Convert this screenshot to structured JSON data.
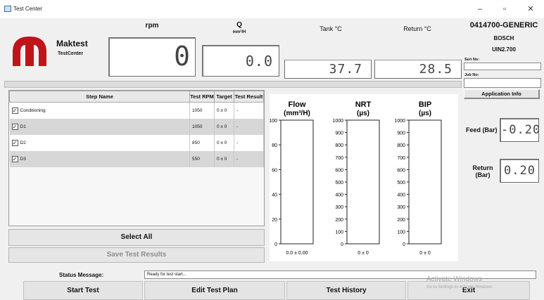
{
  "window": {
    "title": "Test Center",
    "minimize_glyph": "–",
    "maximize_glyph": "▫",
    "close_glyph": "✕"
  },
  "brand": {
    "name": "Maktest",
    "subtitle": "TestCenter",
    "logo_color": "#c0141b"
  },
  "readouts": {
    "rpm": {
      "label": "rpm",
      "value": "0"
    },
    "q": {
      "label": "Q",
      "unit": "mm³/H",
      "value": "0.0"
    },
    "tank": {
      "label": "Tank °C",
      "value": "37.7"
    },
    "return": {
      "label": "Return °C",
      "value": "28.5"
    }
  },
  "device": {
    "code": "0414700-GENERIC",
    "maker": "BOSCH",
    "uin": "UIN2.700",
    "serial_label": "Seri No:",
    "serial_value": "",
    "job_label": "Job No:",
    "job_value": "",
    "info_button": "Application Info"
  },
  "steps_table": {
    "headers": [
      "Step Name",
      "Test RPM",
      "Target",
      "Test Result"
    ],
    "rows": [
      {
        "checked": true,
        "name": "Conditioning",
        "rpm": "1050",
        "target": "0 ± 0",
        "result": "-"
      },
      {
        "checked": true,
        "name": "D1",
        "rpm": "1050",
        "target": "0 ± 0",
        "result": "-"
      },
      {
        "checked": true,
        "name": "D2",
        "rpm": "850",
        "target": "0 ± 0",
        "result": "-"
      },
      {
        "checked": true,
        "name": "D3",
        "rpm": "550",
        "target": "0 ± 0",
        "result": "-"
      }
    ],
    "check_glyph": "✓"
  },
  "buttons": {
    "select_all": "Select All",
    "save_results": "Save Test Results"
  },
  "chart_data": [
    {
      "type": "bar",
      "title": "Flow",
      "unit": "(mm³/H)",
      "ylim": [
        0,
        100
      ],
      "ticks": [
        "0",
        "20",
        "40",
        "60",
        "80",
        "100"
      ],
      "categories": [
        ""
      ],
      "values": [
        0
      ],
      "readout": "0.0 ± 0.00"
    },
    {
      "type": "bar",
      "title": "NRT",
      "unit": "(µs)",
      "ylim": [
        0,
        1000
      ],
      "ticks": [
        "0",
        "100",
        "200",
        "300",
        "400",
        "500",
        "600",
        "700",
        "800",
        "900",
        "1000"
      ],
      "categories": [
        ""
      ],
      "values": [
        0
      ],
      "readout": "0 ± 0"
    },
    {
      "type": "bar",
      "title": "BIP",
      "unit": "(µs)",
      "ylim": [
        0,
        1000
      ],
      "ticks": [
        "0",
        "100",
        "200",
        "300",
        "400",
        "500",
        "600",
        "700",
        "800",
        "900",
        "1000"
      ],
      "categories": [
        ""
      ],
      "values": [
        0
      ],
      "readout": "0 ± 0"
    }
  ],
  "pressures": {
    "feed": {
      "label": "Feed (Bar)",
      "value": "-0.20"
    },
    "return": {
      "label_line1": "Return",
      "label_line2": "(Bar)",
      "value": "0.20"
    }
  },
  "status": {
    "label": "Status Message:",
    "value": "Ready for test start..."
  },
  "bottom_buttons": {
    "start": "Start Test",
    "edit": "Edit Test Plan",
    "history": "Test History",
    "exit": "Exit"
  },
  "watermark": {
    "line1": "Activate Windows",
    "line2": "Go to Settings to activate Windows."
  },
  "colors": {
    "panel_bg": "#f0f0f0",
    "row_alt": "#d7d7d7",
    "logo": "#c0141b"
  }
}
